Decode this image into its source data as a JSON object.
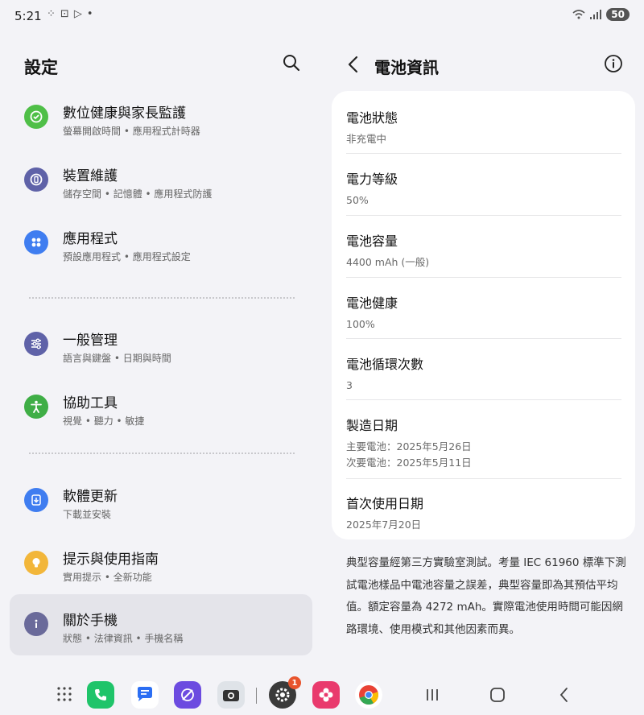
{
  "status_bar": {
    "time": "5:21",
    "battery": "50"
  },
  "left": {
    "title": "設定",
    "menu": [
      {
        "title": "數位健康與家長監護",
        "subtitle": "螢幕開啟時間 • 應用程式計時器",
        "icon": "digital-wellbeing-icon",
        "color": "#4fbf48"
      },
      {
        "title": "裝置維護",
        "subtitle": "儲存空間 • 記憶體 • 應用程式防護",
        "icon": "device-care-icon",
        "color": "#5f62a8"
      },
      {
        "title": "應用程式",
        "subtitle": "預設應用程式 • 應用程式設定",
        "icon": "apps-icon",
        "color": "#3f7df0"
      },
      {
        "title": "一般管理",
        "subtitle": "語言與鍵盤 • 日期與時間",
        "icon": "general-management-icon",
        "color": "#5f62a8"
      },
      {
        "title": "協助工具",
        "subtitle": "視覺 • 聽力 • 敏捷",
        "icon": "accessibility-icon",
        "color": "#3fae46"
      },
      {
        "title": "軟體更新",
        "subtitle": "下載並安裝",
        "icon": "software-update-icon",
        "color": "#3f7df0"
      },
      {
        "title": "提示與使用指南",
        "subtitle": "實用提示 • 全新功能",
        "icon": "tips-icon",
        "color": "#f2b63a"
      },
      {
        "title": "關於手機",
        "subtitle": "狀態 • 法律資訊 • 手機名稱",
        "icon": "about-phone-icon",
        "color": "#6a6a9a"
      }
    ]
  },
  "right": {
    "title": "電池資訊",
    "rows": [
      {
        "title": "電池狀態",
        "value": "非充電中"
      },
      {
        "title": "電力等級",
        "value": "50%"
      },
      {
        "title": "電池容量",
        "value": "4400 mAh (一般)"
      },
      {
        "title": "電池健康",
        "value": "100%"
      },
      {
        "title": "電池循環次數",
        "value": "3"
      },
      {
        "title": "製造日期",
        "value": "主要電池：2025年5月26日",
        "value2": "次要電池：2025年5月11日"
      },
      {
        "title": "首次使用日期",
        "value": "2025年7月20日"
      }
    ],
    "footnote": "典型容量經第三方實驗室測試。考量 IEC 61960 標準下測試電池樣品中電池容量之誤差，典型容量即為其預估平均值。額定容量為 4272 mAh。實際電池使用時間可能因網路環境、使用模式和其他因素而異。"
  },
  "dock": {
    "settings_badge": "1"
  }
}
